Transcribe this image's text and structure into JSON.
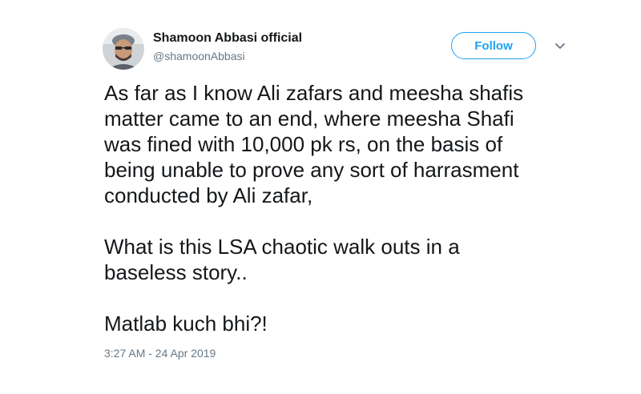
{
  "user": {
    "display_name": "Shamoon Abbasi official",
    "handle": "@shamoonAbbasi",
    "avatar_icon": "profile-photo"
  },
  "header": {
    "follow_label": "Follow",
    "menu_icon": "chevron-down-icon"
  },
  "tweet": {
    "paragraphs": [
      "As far as I know Ali zafars and meesha shafis\nmatter came to an end, where meesha Shafi\nwas fined with 10,000 pk rs, on the basis of\nbeing unable to prove any sort of harrasment\nconducted by Ali zafar,",
      "What is this LSA chaotic walk outs in a\nbaseless story..",
      "Matlab kuch bhi?!"
    ],
    "timestamp": "3:27 AM - 24 Apr 2019"
  },
  "colors": {
    "accent": "#1da1f2",
    "text": "#14171a",
    "secondary": "#657786"
  }
}
